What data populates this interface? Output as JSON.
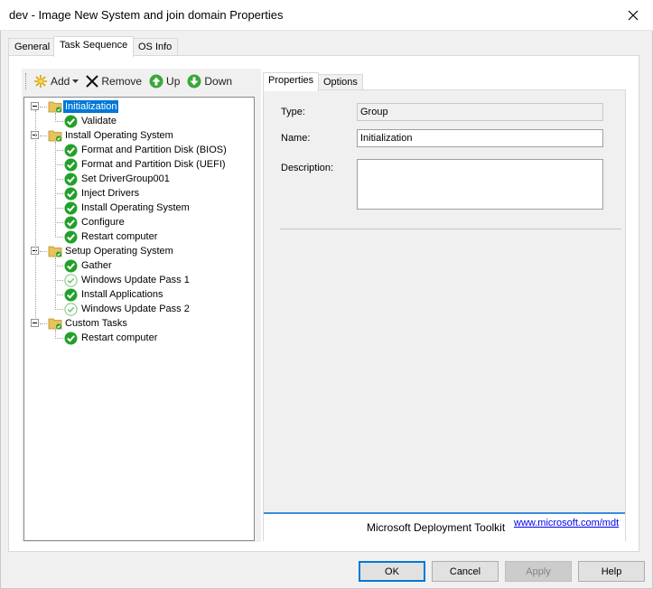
{
  "window": {
    "title": "dev - Image New System and join domain Properties"
  },
  "tabs": [
    {
      "label": "General"
    },
    {
      "label": "Task Sequence"
    },
    {
      "label": "OS Info"
    }
  ],
  "toolbar": {
    "add_label": "Add",
    "remove_label": "Remove",
    "up_label": "Up",
    "down_label": "Down"
  },
  "tree": {
    "groups": [
      {
        "label": "Initialization",
        "selected": true,
        "children": [
          {
            "label": "Validate",
            "status": "enabled"
          }
        ]
      },
      {
        "label": "Install Operating System",
        "children": [
          {
            "label": "Format and Partition Disk (BIOS)",
            "status": "enabled"
          },
          {
            "label": "Format and Partition Disk (UEFI)",
            "status": "enabled"
          },
          {
            "label": "Set DriverGroup001",
            "status": "enabled"
          },
          {
            "label": "Inject Drivers",
            "status": "enabled"
          },
          {
            "label": "Install Operating System",
            "status": "enabled"
          },
          {
            "label": "Configure",
            "status": "enabled"
          },
          {
            "label": "Restart computer",
            "status": "enabled"
          }
        ]
      },
      {
        "label": "Setup Operating System",
        "children": [
          {
            "label": "Gather",
            "status": "enabled"
          },
          {
            "label": "Windows Update Pass 1",
            "status": "disabled"
          },
          {
            "label": "Install Applications",
            "status": "enabled"
          },
          {
            "label": "Windows Update Pass 2",
            "status": "disabled"
          }
        ]
      },
      {
        "label": "Custom Tasks",
        "children": [
          {
            "label": "Restart computer",
            "status": "enabled"
          }
        ]
      }
    ]
  },
  "properties": {
    "tabs": [
      {
        "label": "Properties"
      },
      {
        "label": "Options"
      }
    ],
    "type_label": "Type:",
    "type_value": "Group",
    "name_label": "Name:",
    "name_value": "Initialization",
    "description_label": "Description:",
    "description_value": "",
    "footer_brand": "Microsoft Deployment Toolkit",
    "footer_link": "www.microsoft.com/mdt"
  },
  "buttons": {
    "ok": "OK",
    "cancel": "Cancel",
    "apply": "Apply",
    "help": "Help"
  },
  "colors": {
    "selection": "#0078d7",
    "check_green": "#22a02a",
    "folder_yellow": "#e8c25a",
    "footer_accent": "#3c8ddd"
  }
}
